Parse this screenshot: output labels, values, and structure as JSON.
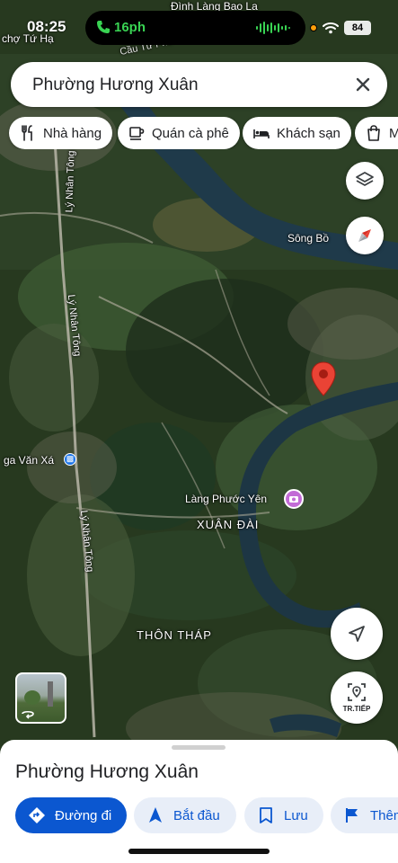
{
  "status_bar": {
    "time": "08:25",
    "call_duration": "16ph",
    "battery": "84"
  },
  "search": {
    "query": "Phường Hương Xuân"
  },
  "chips": [
    {
      "label": "Nhà hàng",
      "icon": "fork-knife-icon"
    },
    {
      "label": "Quán cà phê",
      "icon": "coffee-cup-icon"
    },
    {
      "label": "Khách sạn",
      "icon": "bed-icon"
    },
    {
      "label": "Mua sắm",
      "icon": "shopping-bag-icon"
    }
  ],
  "map": {
    "labels": {
      "top_village": "Đình Làng Bao La",
      "top_left_place": "chợ Tứ Hạ",
      "bridge": "Cầu Tứ Phú",
      "river": "Sông Bồ",
      "road_top": "Lý Nhân Tông",
      "road_middle": "Lý Nhân Tông",
      "road_bottom": "Lý Nhân Tông",
      "station": "ga Văn Xá",
      "village": "Làng Phước Yên",
      "district": "XUÂN ĐÀI",
      "hamlet": "THÔN THÁP"
    },
    "pin_color": "#ea4335",
    "poi_color": "#c26bd6"
  },
  "controls": {
    "live_view_label": "TR.TIẾP"
  },
  "place": {
    "name": "Phường Hương Xuân"
  },
  "actions": {
    "directions": "Đường đi",
    "start": "Bắt đầu",
    "save": "Lưu",
    "more": "Thêm"
  },
  "colors": {
    "accent": "#0b57d0",
    "accent_soft": "#e8eef8"
  }
}
